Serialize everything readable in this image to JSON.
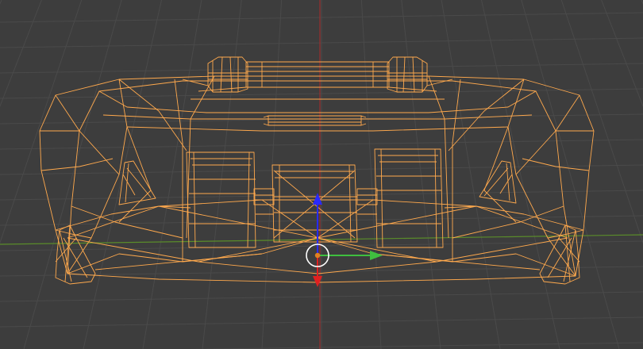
{
  "viewport": {
    "background": "#3d3d3d",
    "grid_color": "#4a4a4a",
    "x_axis_color": "#5a8c2a",
    "z_axis_color": "#9a2f2f",
    "wireframe_color": "#ffa94d",
    "view": "front",
    "shading": "wireframe"
  },
  "gizmo": {
    "x_arrow_color": "#3fbf3f",
    "y_arrow_color": "#2a2aff",
    "z_arrow_color": "#e02020",
    "pivot_color": "#e08020",
    "ring_color": "#ffffff"
  },
  "icons": [
    "transform-gizmo-icon",
    "origin-pivot-icon"
  ]
}
